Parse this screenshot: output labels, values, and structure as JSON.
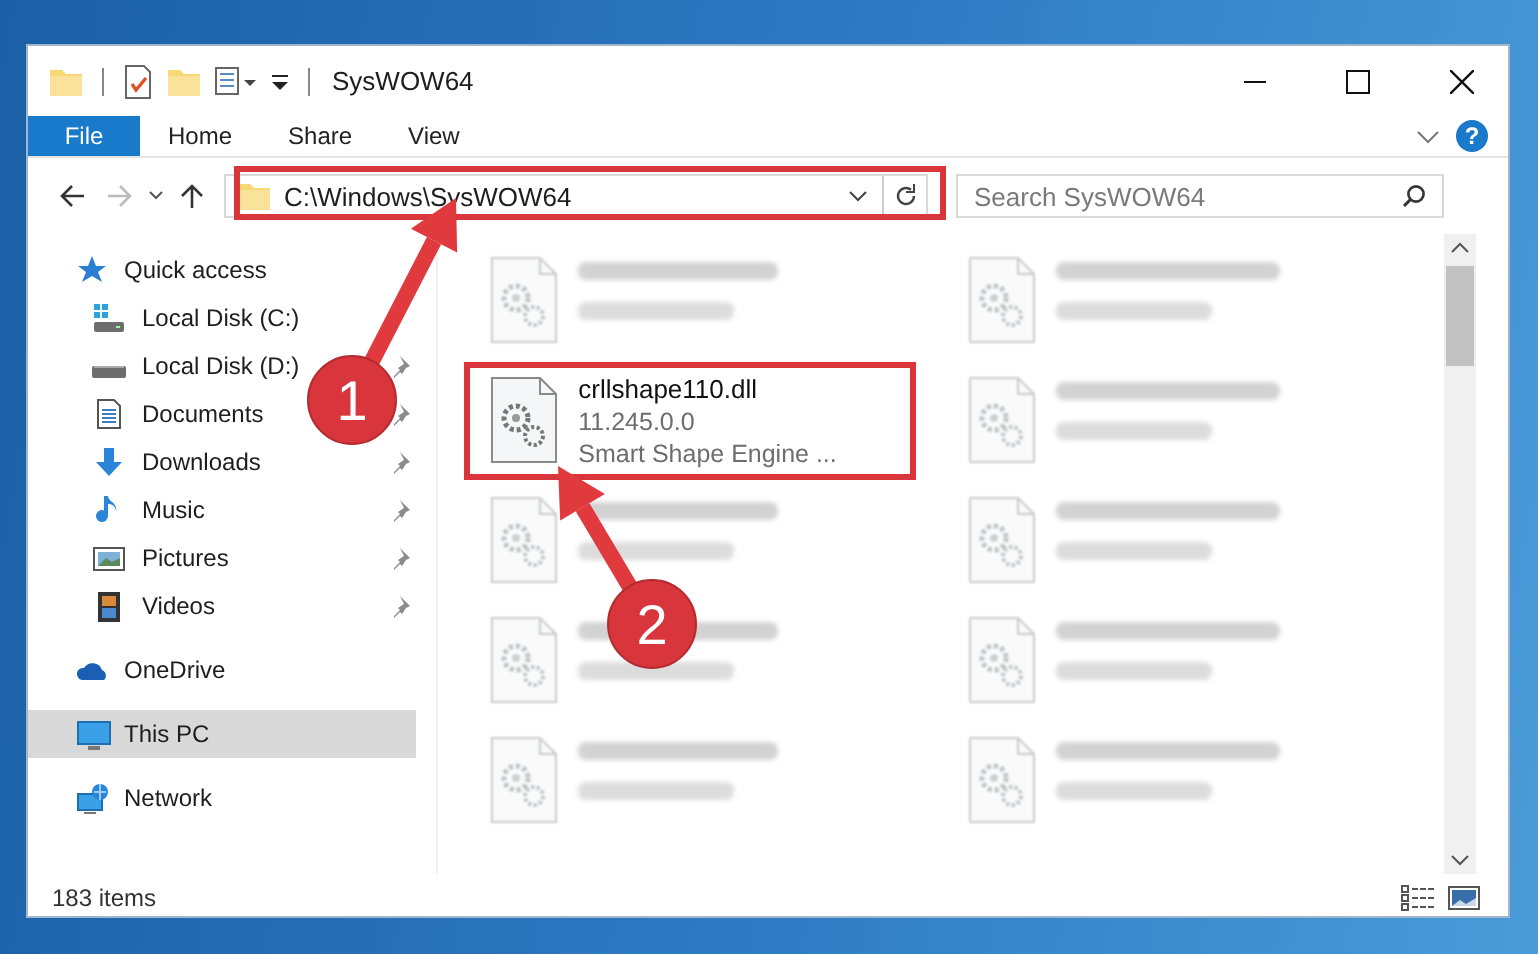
{
  "window": {
    "title": "SysWOW64"
  },
  "ribbon": {
    "tabs": [
      {
        "label": "File",
        "kind": "menu"
      },
      {
        "label": "Home",
        "kind": "tab"
      },
      {
        "label": "Share",
        "kind": "tab"
      },
      {
        "label": "View",
        "kind": "tab"
      }
    ],
    "help": "?"
  },
  "address_bar": {
    "path": "C:\\Windows\\SysWOW64"
  },
  "search": {
    "placeholder": "Search SysWOW64"
  },
  "sidebar": {
    "items": [
      {
        "label": "Quick access",
        "kind": "star",
        "selected": false,
        "children": [
          {
            "label": "Local Disk (C:)",
            "kind": "system-drive",
            "pinned": false,
            "selected": false
          },
          {
            "label": "Local Disk (D:)",
            "kind": "drive",
            "pinned": true,
            "selected": false
          },
          {
            "label": "Documents",
            "kind": "documents",
            "pinned": true,
            "selected": false
          },
          {
            "label": "Downloads",
            "kind": "downloads",
            "pinned": true,
            "selected": false
          },
          {
            "label": "Music",
            "kind": "music",
            "pinned": true,
            "selected": false
          },
          {
            "label": "Pictures",
            "kind": "pictures",
            "pinned": true,
            "selected": false
          },
          {
            "label": "Videos",
            "kind": "videos",
            "pinned": true,
            "selected": false
          }
        ]
      },
      {
        "label": "OneDrive",
        "kind": "cloud",
        "selected": false
      },
      {
        "label": "This PC",
        "kind": "computer",
        "selected": true
      },
      {
        "label": "Network",
        "kind": "network",
        "selected": false
      }
    ]
  },
  "files": [
    {
      "blurred": true
    },
    {
      "blurred": true
    },
    {
      "name": "crllshape110.dll",
      "details": [
        "11.245.0.0",
        "Smart Shape Engine ..."
      ],
      "blurred": false
    },
    {
      "blurred": true
    },
    {
      "blurred": true
    },
    {
      "blurred": true
    },
    {
      "blurred": true
    },
    {
      "blurred": true
    },
    {
      "blurred": true
    },
    {
      "blurred": true
    }
  ],
  "status_bar": {
    "item_count": "183 items"
  },
  "annotations": [
    {
      "number": "1"
    },
    {
      "number": "2"
    }
  ]
}
